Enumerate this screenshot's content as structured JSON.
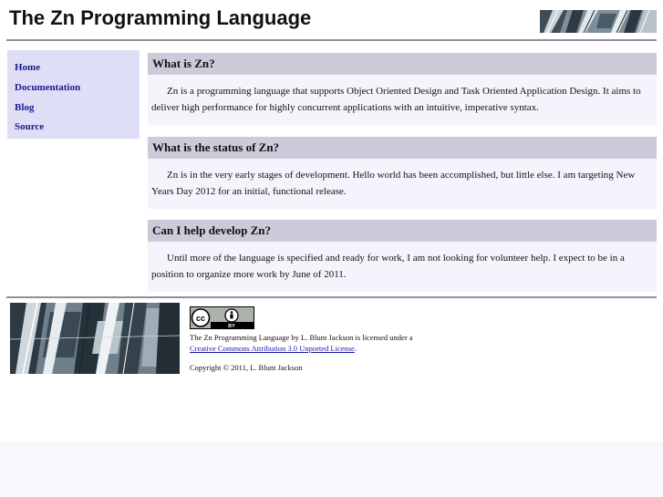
{
  "header": {
    "title": "The Zn Programming Language"
  },
  "sidebar": {
    "items": [
      {
        "label": "Home"
      },
      {
        "label": "Documentation"
      },
      {
        "label": "Blog"
      },
      {
        "label": "Source"
      }
    ]
  },
  "sections": [
    {
      "heading": "What is Zn?",
      "body": "Zn is a programming language that supports Object Oriented Design and Task Oriented Application Design. It aims to deliver high performance for highly concurrent applications with an intuitive, imperative syntax."
    },
    {
      "heading": "What is the status of Zn?",
      "body": "Zn is in the very early stages of development. Hello world has been accomplished, but little else. I am targeting New Years Day 2012 for an initial, functional release."
    },
    {
      "heading": "Can I help develop Zn?",
      "body": "Until more of the language is specified and ready for work, I am not looking for volunteer help. I expect to be in a position to organize more work by June of 2011."
    }
  ],
  "footer": {
    "cc_badge": {
      "cc": "cc",
      "by": "BY"
    },
    "license_text": "The Zn Programming Language by L. Blunt Jackson is licensed under a",
    "license_link": "Creative Commons Attribution 3.0 Unported License",
    "license_suffix": ".",
    "copyright": "Copyright © 2011, L. Blunt Jackson"
  },
  "colors": {
    "page_background": "#f7f7fd",
    "nav_background": "#dedef6",
    "nav_link": "#1a1a8c",
    "section_header_background": "#cbcbd9",
    "section_background": "#f4f4fc",
    "rule": "#8f8f9f"
  }
}
